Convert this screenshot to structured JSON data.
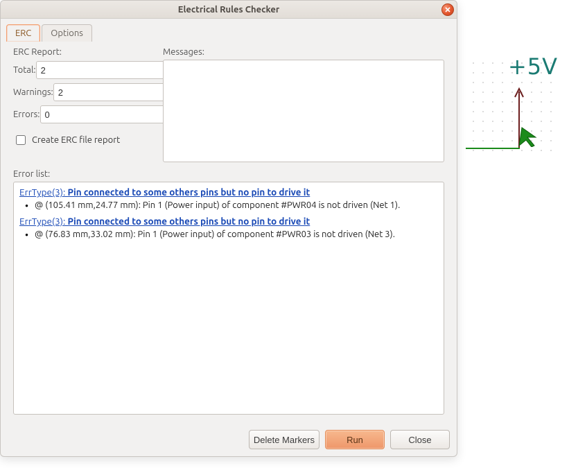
{
  "window": {
    "title": "Electrical Rules Checker"
  },
  "tabs": {
    "erc": "ERC",
    "options": "Options"
  },
  "report": {
    "heading": "ERC Report:",
    "total_label": "Total:",
    "total_value": "2",
    "warnings_label": "Warnings:",
    "warnings_value": "2",
    "errors_label": "Errors:",
    "errors_value": "0",
    "create_file_label": "Create ERC file report"
  },
  "messages": {
    "heading": "Messages:"
  },
  "error_list": {
    "heading": "Error list:",
    "items": [
      {
        "link_prefix": "ErrType(3): ",
        "link_bold": "Pin connected to some others pins but no pin to drive it",
        "detail": "@ (105.41 mm,24.77 mm): Pin 1 (Power input) of component #PWR04 is not driven (Net 1)."
      },
      {
        "link_prefix": "ErrType(3): ",
        "link_bold": "Pin connected to some others pins but no pin to drive it",
        "detail": "@ (76.83 mm,33.02 mm): Pin 1 (Power input) of component #PWR03 is not driven (Net 3)."
      }
    ]
  },
  "buttons": {
    "delete": "Delete Markers",
    "run": "Run",
    "close": "Close"
  },
  "schematic": {
    "voltage_label": "+5V"
  }
}
